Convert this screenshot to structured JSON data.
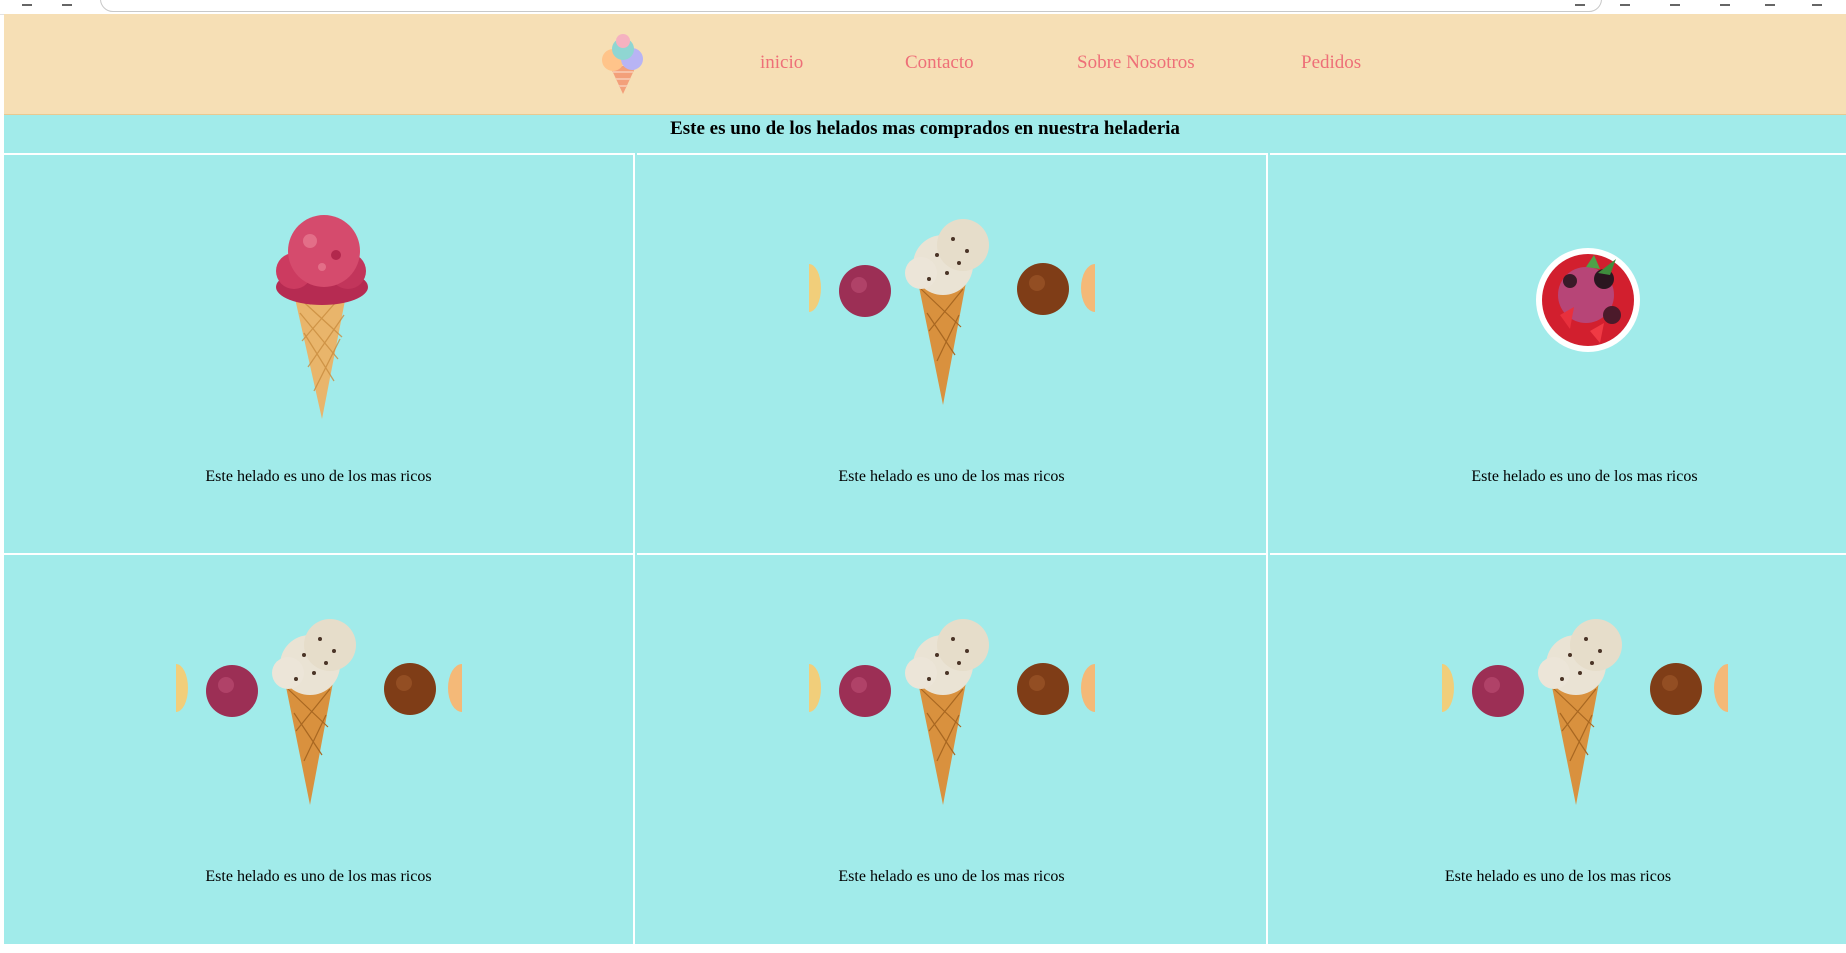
{
  "nav": {
    "logo_icon": "ice-cream-logo-icon",
    "items": [
      {
        "label": "inicio"
      },
      {
        "label": "Contacto"
      },
      {
        "label": "Sobre Nosotros"
      },
      {
        "label": "Pedidos"
      }
    ],
    "link_color": "#ee6f78",
    "bg_color": "#f6dfb5"
  },
  "headline": "Este es uno de los helados mas comprados en nuestra heladeria",
  "page_bg": "#a1ebea",
  "cards": [
    {
      "image": "strawberry-cone-icon",
      "caption": "Este helado es uno de los mas ricos"
    },
    {
      "image": "cookie-cone-with-scoops-icon",
      "caption": "Este helado es uno de los mas ricos"
    },
    {
      "image": "berry-sorbet-bowl-icon",
      "caption": "Este helado es uno de los mas ricos"
    },
    {
      "image": "cookie-cone-with-scoops-icon",
      "caption": "Este helado es uno de los mas ricos"
    },
    {
      "image": "cookie-cone-with-scoops-icon",
      "caption": "Este helado es uno de los mas ricos"
    },
    {
      "image": "cookie-cone-with-scoops-icon",
      "caption": "Este helado es uno de los mas ricos"
    }
  ]
}
